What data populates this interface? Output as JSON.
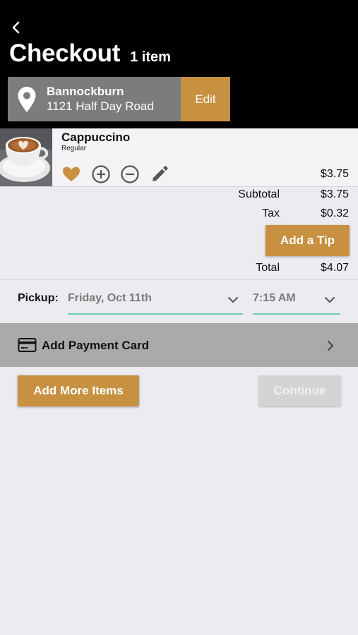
{
  "header": {
    "title": "Checkout",
    "item_count": "1 item",
    "back_icon": "chevron-left-icon"
  },
  "location": {
    "name": "Bannockburn",
    "address": "1121 Half Day Road",
    "edit_label": "Edit",
    "icon": "map-pin-icon"
  },
  "cart": {
    "items": [
      {
        "name": "Cappuccino",
        "size": "Regular",
        "price": "$3.75",
        "actions": [
          "heart-icon",
          "plus-circle-icon",
          "minus-circle-icon",
          "pencil-icon"
        ]
      }
    ]
  },
  "summary": {
    "subtotal_label": "Subtotal",
    "subtotal": "$3.75",
    "tax_label": "Tax",
    "tax": "$0.32",
    "tip_button": "Add a Tip",
    "total_label": "Total",
    "total": "$4.07"
  },
  "pickup": {
    "label": "Pickup:",
    "date": "Friday, Oct 11th",
    "time": "7:15 AM"
  },
  "payment": {
    "label": "Add Payment Card",
    "icon": "credit-card-icon"
  },
  "actions": {
    "add_more": "Add More Items",
    "continue": "Continue"
  },
  "colors": {
    "accent": "#c89141",
    "header_bg": "#000000",
    "location_bg": "#7c7c7c",
    "select_underline": "#6ccfae",
    "payment_bg": "#aaaaab",
    "page_bg": "#ebebf0",
    "disabled_bg": "#d4d4d6"
  }
}
